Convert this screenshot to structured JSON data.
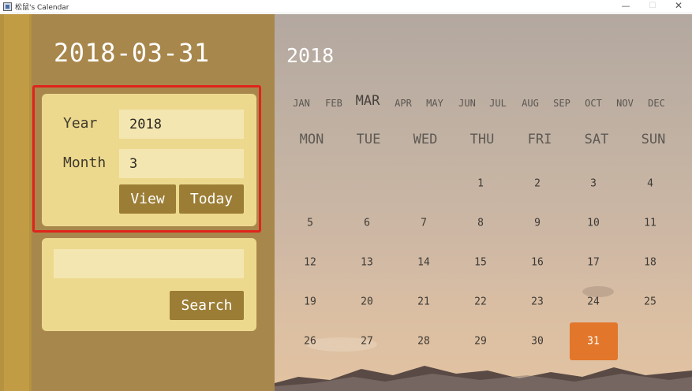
{
  "window": {
    "title": "松鼠's Calendar",
    "minimize": "—",
    "maximize": "☐",
    "close": "✕"
  },
  "selected_date": "2018-03-31",
  "query": {
    "year_label": "Year",
    "year_value": "2018",
    "month_label": "Month",
    "month_value": "3",
    "view_button": "View",
    "today_button": "Today"
  },
  "search": {
    "value": "",
    "button": "Search"
  },
  "calendar": {
    "year": "2018",
    "months": [
      "JAN",
      "FEB",
      "MAR",
      "APR",
      "MAY",
      "JUN",
      "JUL",
      "AUG",
      "SEP",
      "OCT",
      "NOV",
      "DEC"
    ],
    "active_month": "MAR",
    "weekdays": [
      "MON",
      "TUE",
      "WED",
      "THU",
      "FRI",
      "SAT",
      "SUN"
    ],
    "weeks": [
      [
        "",
        "",
        "",
        "1",
        "2",
        "3",
        "4"
      ],
      [
        "5",
        "6",
        "7",
        "8",
        "9",
        "10",
        "11"
      ],
      [
        "12",
        "13",
        "14",
        "15",
        "16",
        "17",
        "18"
      ],
      [
        "19",
        "20",
        "21",
        "22",
        "23",
        "24",
        "25"
      ],
      [
        "26",
        "27",
        "28",
        "29",
        "30",
        "31",
        ""
      ]
    ],
    "today": "31"
  },
  "colors": {
    "panel": "#a8874c",
    "card": "#ecd98e",
    "button": "#9c7d35",
    "today_highlight": "#e2762a",
    "selection_outline": "#e0241c"
  }
}
